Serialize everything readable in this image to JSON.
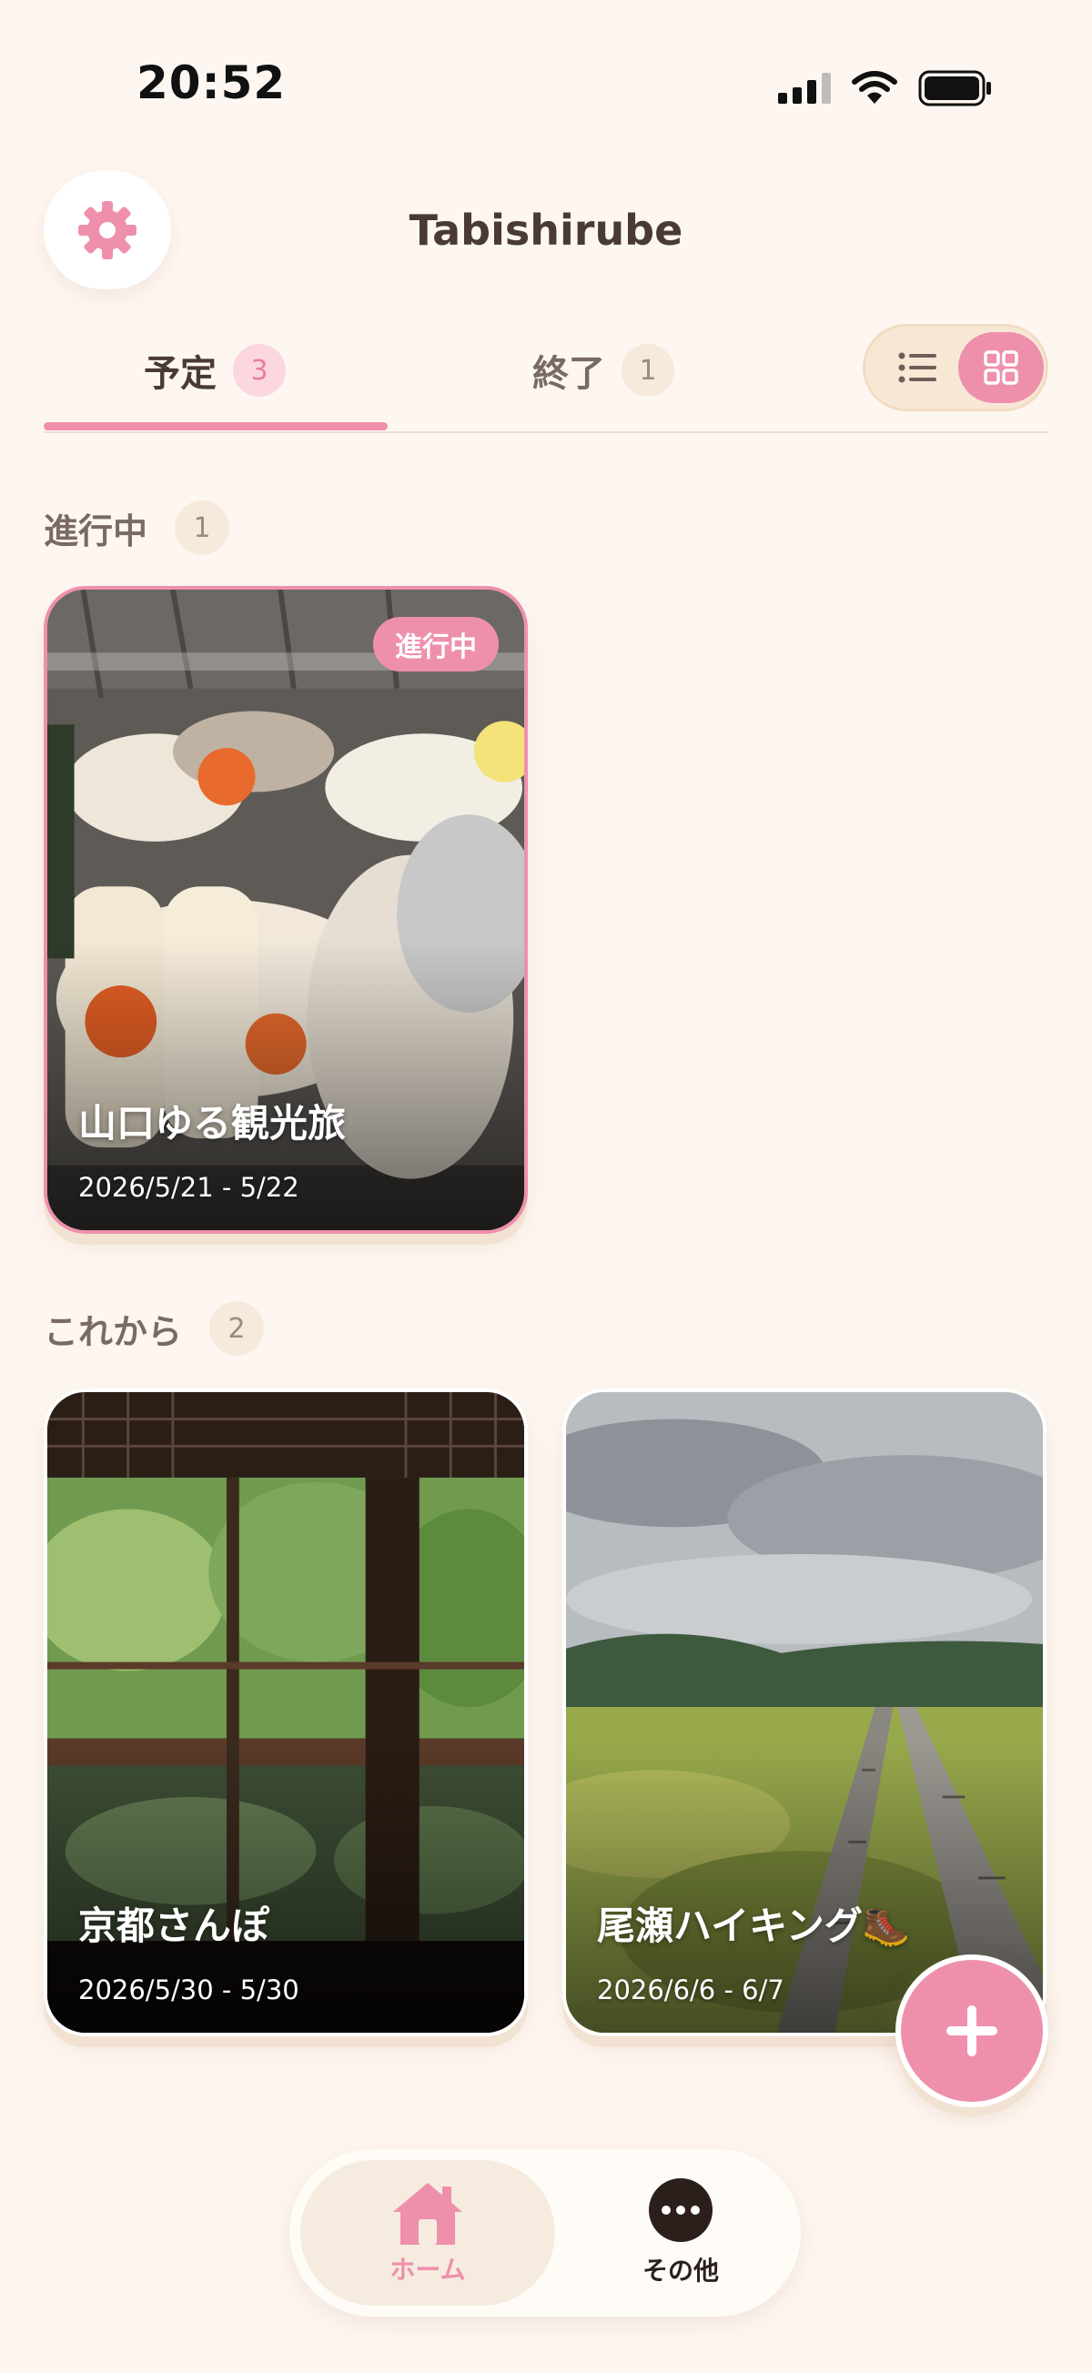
{
  "status_bar": {
    "time": "20:52"
  },
  "header": {
    "title": "Tabishirube",
    "settings_icon": "gear-icon"
  },
  "tabs": [
    {
      "label": "予定",
      "count": "3",
      "selected": true
    },
    {
      "label": "終了",
      "count": "1",
      "selected": false
    }
  ],
  "view_toggle": {
    "options": [
      "list",
      "grid"
    ],
    "selected": "grid"
  },
  "sections": {
    "ongoing": {
      "title": "進行中",
      "count": "1"
    },
    "upcoming": {
      "title": "これから",
      "count": "2"
    }
  },
  "trips": {
    "ongoing": [
      {
        "title": "山口ゆる観光旅",
        "dates": "2026/5/21 - 5/22",
        "badge": "進行中",
        "photo": "sushi-platter"
      }
    ],
    "upcoming": [
      {
        "title": "京都さんぽ",
        "dates": "2026/5/30 - 5/30",
        "photo": "temple-window-reflection"
      },
      {
        "title": "尾瀬ハイキング🥾",
        "dates": "2026/6/6 - 6/7",
        "photo": "marsh-boardwalk"
      }
    ]
  },
  "fab": {
    "icon": "plus-icon"
  },
  "bottom_nav": [
    {
      "label": "ホーム",
      "icon": "home-icon",
      "selected": true
    },
    {
      "label": "その他",
      "icon": "more-icon",
      "selected": false
    }
  ],
  "colors": {
    "accent": "#EE90AC",
    "background": "#FEF7F1",
    "text": "#4A3A36"
  }
}
